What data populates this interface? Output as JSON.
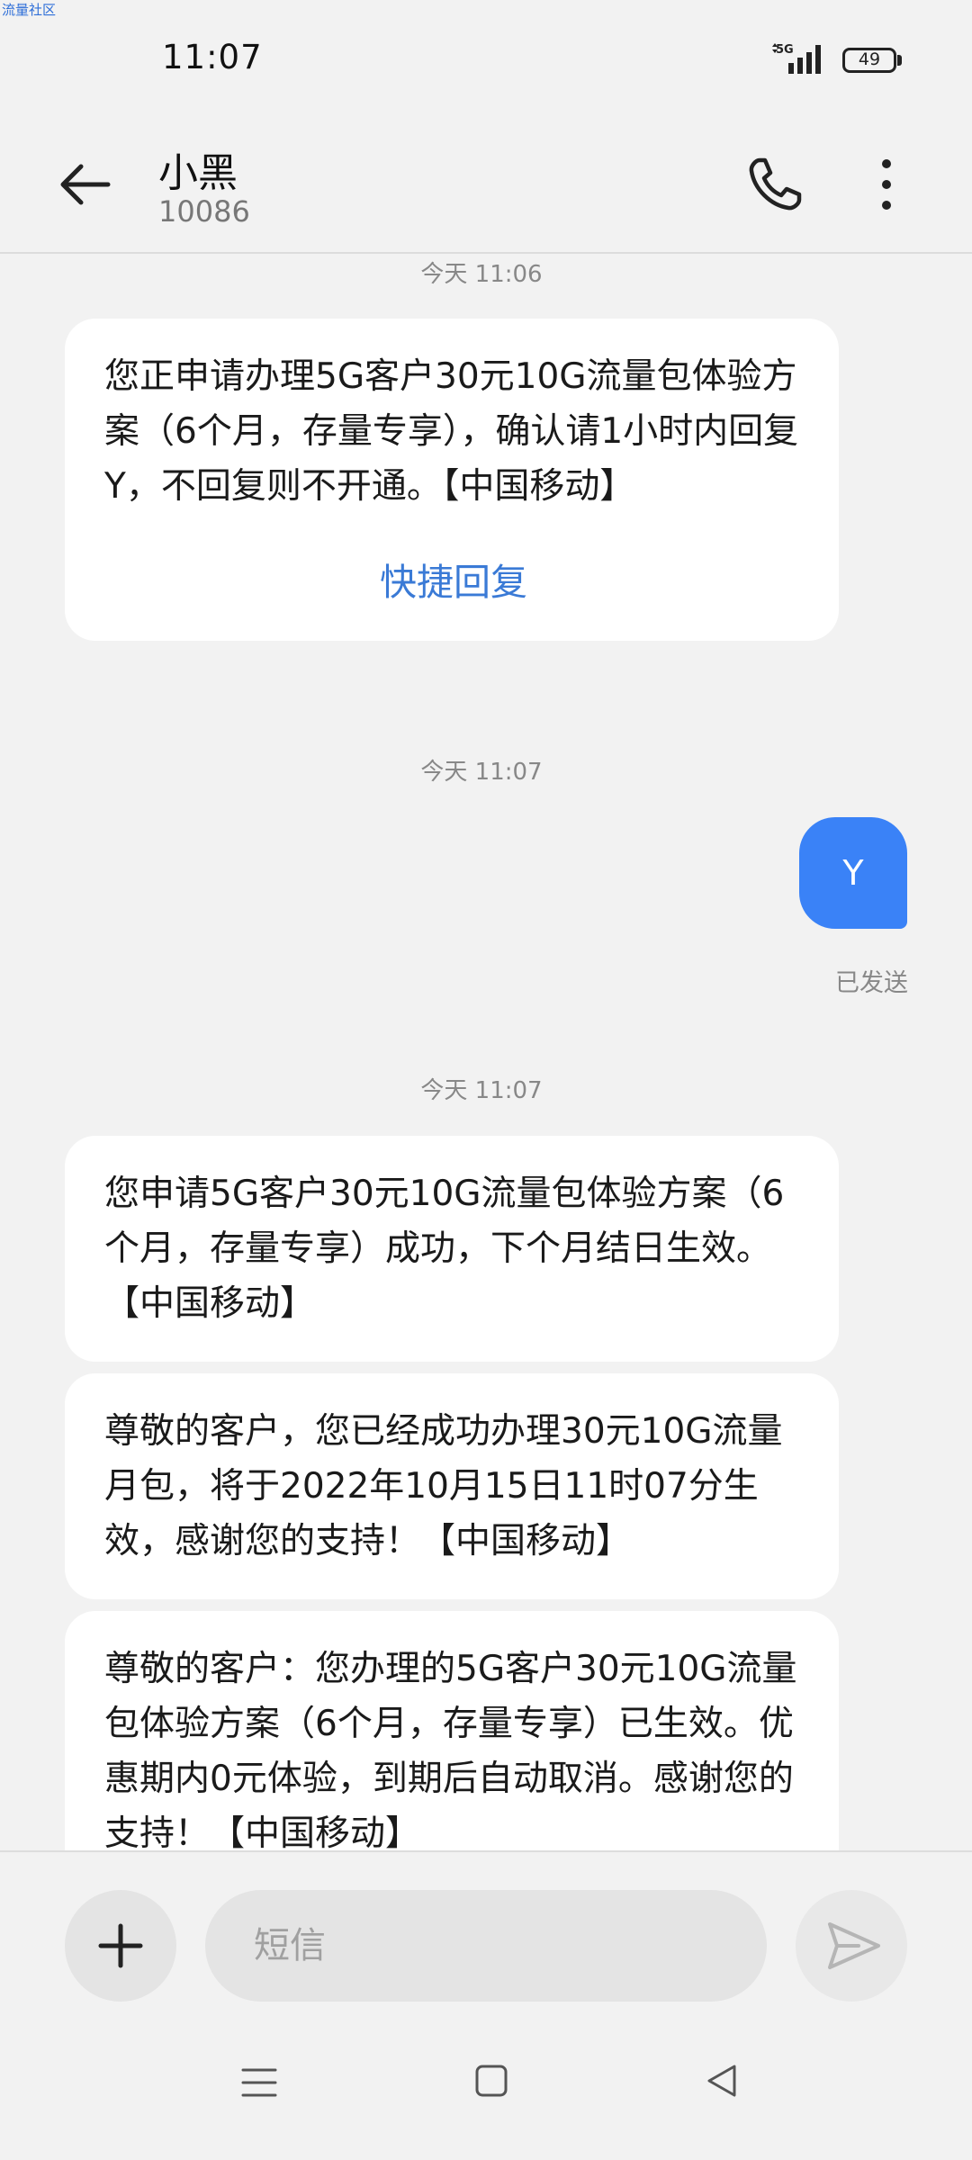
{
  "watermark": "流量社区",
  "status_bar": {
    "time": "11:07",
    "network": "5G",
    "battery": "49"
  },
  "header": {
    "contact_name": "小黑",
    "contact_number": "10086",
    "icons": [
      "back-arrow-icon",
      "phone-icon",
      "more-vertical-icon"
    ]
  },
  "messages": {
    "ts1": "今天 11:06",
    "msg1": "您正申请办理5G客户30元10G流量包体验方案（6个月，存量专享），确认请1小时内回复Y，不回复则不开通。【中国移动】",
    "quick_reply": "快捷回复",
    "ts2": "今天 11:07",
    "sent_text": "Y",
    "sent_status": "已发送",
    "ts3": "今天 11:07",
    "msg2": "您申请5G客户30元10G流量包体验方案（6个月，存量专享）成功，下个月结日生效。【中国移动】",
    "msg3": "尊敬的客户，您已经成功办理30元10G流量月包，将于2022年10月15日11时07分生效，感谢您的支持！【中国移动】",
    "msg4": "尊敬的客户：您办理的5G客户30元10G流量包体验方案（6个月，存量专享）已生效。优惠期内0元体验，到期后自动取消。感谢您的支持！【中国移动】"
  },
  "composer": {
    "placeholder": "短信"
  },
  "colors": {
    "accent": "#3a82f7",
    "link": "#3a7ad6",
    "background": "#f2f2f2"
  }
}
